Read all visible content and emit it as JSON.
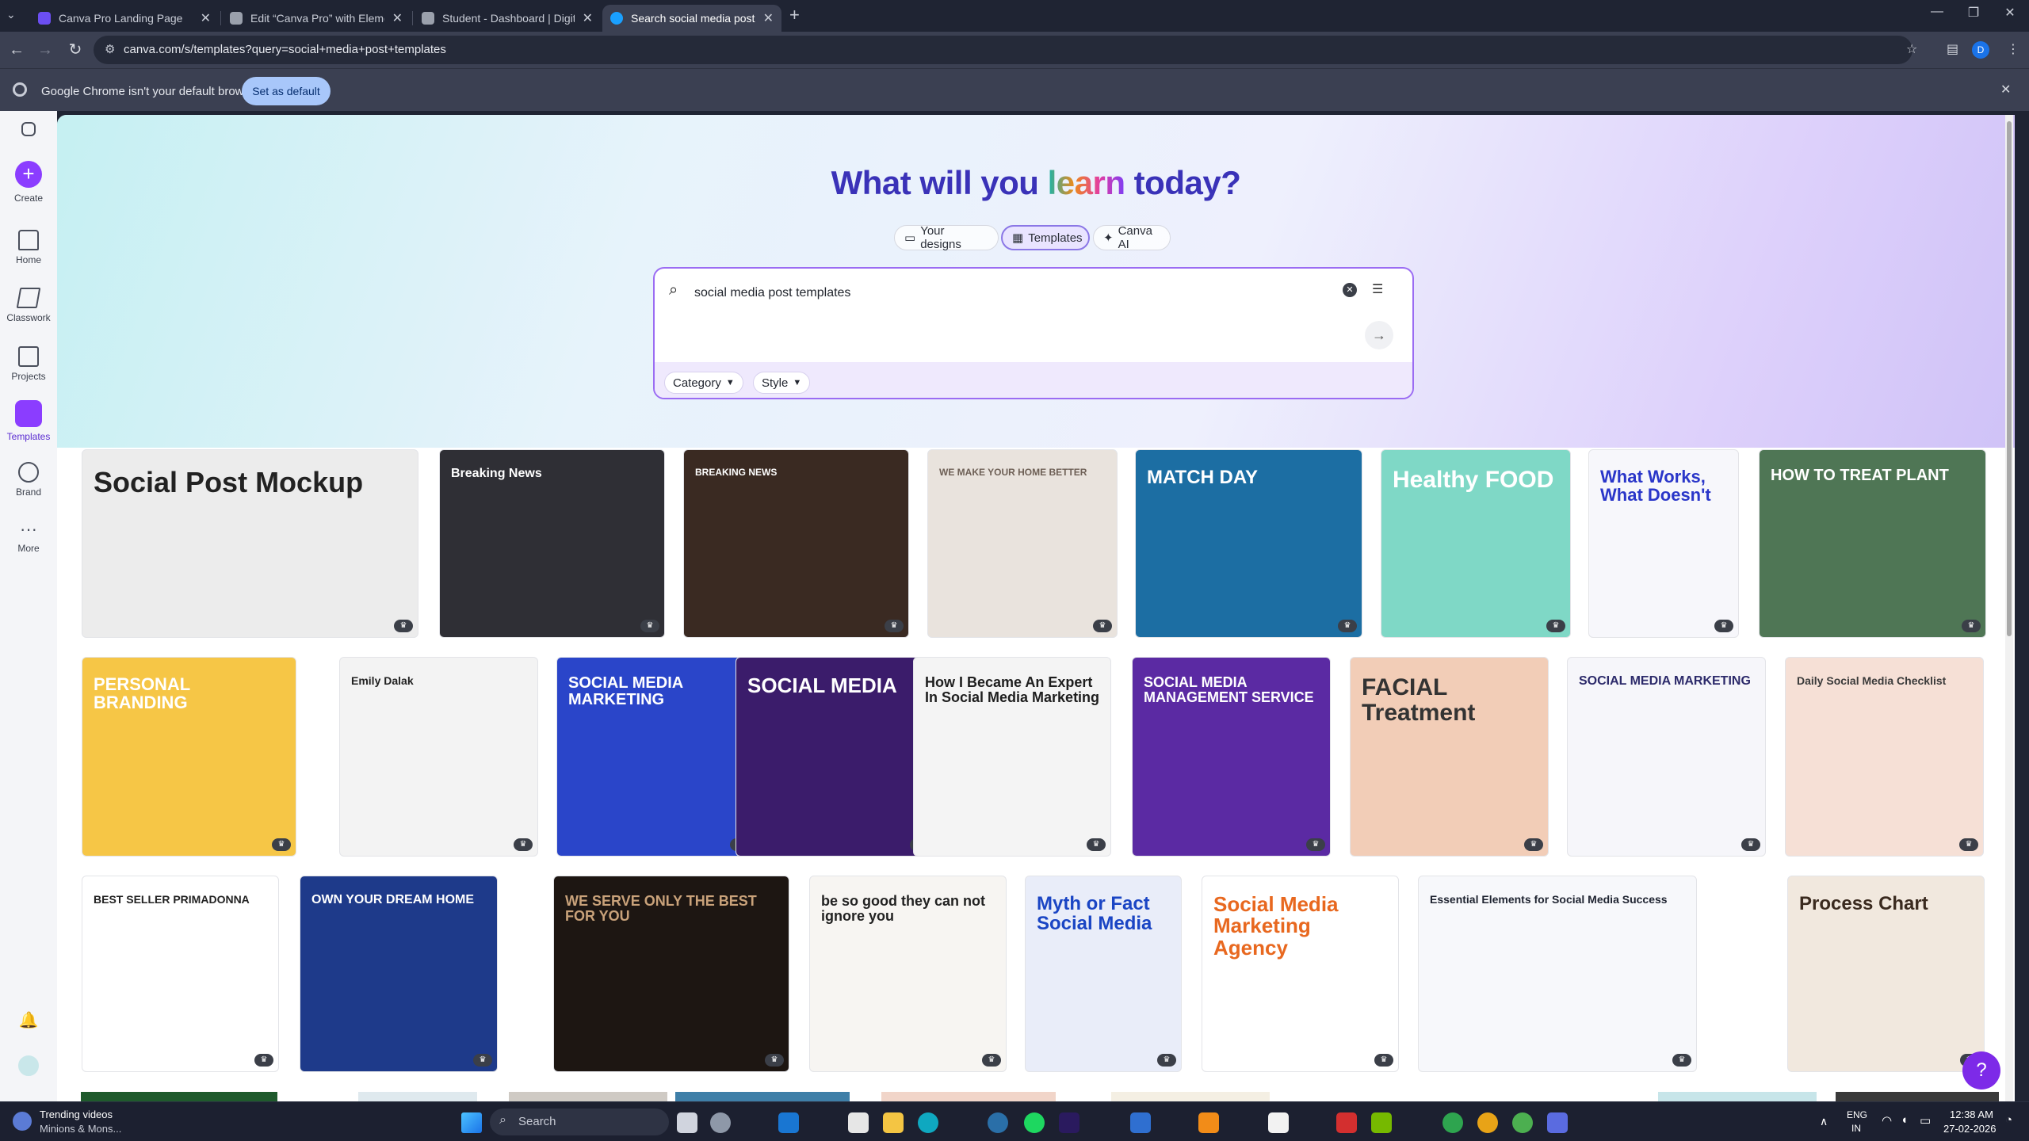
{
  "browser": {
    "tabs": [
      {
        "title": "Canva Pro Landing Page",
        "favicon_color": "#6b4ef2"
      },
      {
        "title": "Edit “Canva Pro” with Elemento",
        "favicon_color": "#9aa0ac"
      },
      {
        "title": "Student - Dashboard | Digital T",
        "favicon_color": "#9aa0ac"
      },
      {
        "title": "Search social media post templ",
        "favicon_color": "#1aa0ff"
      }
    ],
    "url": "canva.com/s/templates?query=social+media+post+templates",
    "infobar_text": "Google Chrome isn't your default browser",
    "set_default_label": "Set as default",
    "profile_initial": "D"
  },
  "sidebar": {
    "items": [
      {
        "label": "Create",
        "icon": "plus-icon"
      },
      {
        "label": "Home",
        "icon": "home-icon"
      },
      {
        "label": "Classwork",
        "icon": "graduation-cap-icon"
      },
      {
        "label": "Projects",
        "icon": "folder-icon"
      },
      {
        "label": "Templates",
        "icon": "templates-icon"
      },
      {
        "label": "Brand",
        "icon": "brand-icon"
      },
      {
        "label": "More",
        "icon": "more-dots-icon"
      }
    ]
  },
  "hero": {
    "headline_part1": "What will you ",
    "headline_part2": "learn",
    "headline_part3": " today?",
    "tabs": [
      "Your designs",
      "Templates",
      "Canva AI"
    ],
    "selected_tab": "Templates",
    "search_value": "social media post templates",
    "filters": [
      "Category",
      "Style"
    ]
  },
  "templates": [
    {
      "title": "Social Post Mockup",
      "bg": "#ececec",
      "fg": "#222222"
    },
    {
      "title": "Breaking News",
      "bg": "#2f2f35",
      "fg": "#ffffff"
    },
    {
      "title": "BREAKING NEWS",
      "bg": "#3a2a22",
      "fg": "#ffffff"
    },
    {
      "title": "WE MAKE YOUR HOME BETTER",
      "bg": "#e9e3dd",
      "fg": "#6d5f55"
    },
    {
      "title": "MATCH DAY",
      "bg": "#1c6ea3",
      "fg": "#ffffff"
    },
    {
      "title": "Healthy FOOD",
      "bg": "#7fd8c6",
      "fg": "#ffffff"
    },
    {
      "title": "What Works, What Doesn't",
      "bg": "#f7f7fb",
      "fg": "#2a36c9"
    },
    {
      "title": "HOW TO TREAT PLANT",
      "bg": "#4f7655",
      "fg": "#ffffff"
    },
    {
      "title": "PERSONAL BRANDING",
      "bg": "#f6c646",
      "fg": "#ffffff"
    },
    {
      "title": "Emily Dalak",
      "bg": "#f3f3f3",
      "fg": "#222222"
    },
    {
      "title": "SOCIAL MEDIA MARKETING",
      "bg": "#2a45c9",
      "fg": "#ffffff"
    },
    {
      "title": "SOCIAL MEDIA",
      "bg": "#3b1c6b",
      "fg": "#ffffff"
    },
    {
      "title": "How I Became An Expert In Social Media Marketing",
      "bg": "#f4f4f4",
      "fg": "#1e1e1e"
    },
    {
      "title": "SOCIAL MEDIA MANAGEMENT SERVICE",
      "bg": "#5b2aa3",
      "fg": "#ffffff"
    },
    {
      "title": "FACIAL Treatment",
      "bg": "#f2cdb7",
      "fg": "#333333"
    },
    {
      "title": "SOCIAL MEDIA MARKETING",
      "bg": "#f6f6fa",
      "fg": "#2c2a6a"
    },
    {
      "title": "Daily Social Media Checklist",
      "bg": "#f6e0d6",
      "fg": "#3a3a3a"
    },
    {
      "title": "BEST SELLER PRIMADONNA",
      "bg": "#ffffff",
      "fg": "#222222"
    },
    {
      "title": "OWN YOUR DREAM HOME",
      "bg": "#1e3a8a",
      "fg": "#ffffff"
    },
    {
      "title": "WE SERVE ONLY THE BEST FOR YOU",
      "bg": "#1d1612",
      "fg": "#c9a27a"
    },
    {
      "title": "be so good they can not ignore you",
      "bg": "#f7f5f2",
      "fg": "#222222"
    },
    {
      "title": "Myth or Fact Social Media",
      "bg": "#e9edf9",
      "fg": "#1a45c4"
    },
    {
      "title": "Social Media Marketing Agency",
      "bg": "#ffffff",
      "fg": "#e8681f"
    },
    {
      "title": "Essential Elements for Social Media Success",
      "bg": "#f7f8fb",
      "fg": "#1e2330"
    },
    {
      "title": "Process Chart",
      "bg": "#f1e8de",
      "fg": "#3a2a1f"
    }
  ],
  "help_label": "?",
  "taskbar": {
    "widget_title": "Trending videos",
    "widget_sub": "Minions & Mons...",
    "search_placeholder": "Search",
    "lang": "ENG",
    "region": "IN",
    "time": "12:38 AM",
    "date": "27-02-2026"
  }
}
